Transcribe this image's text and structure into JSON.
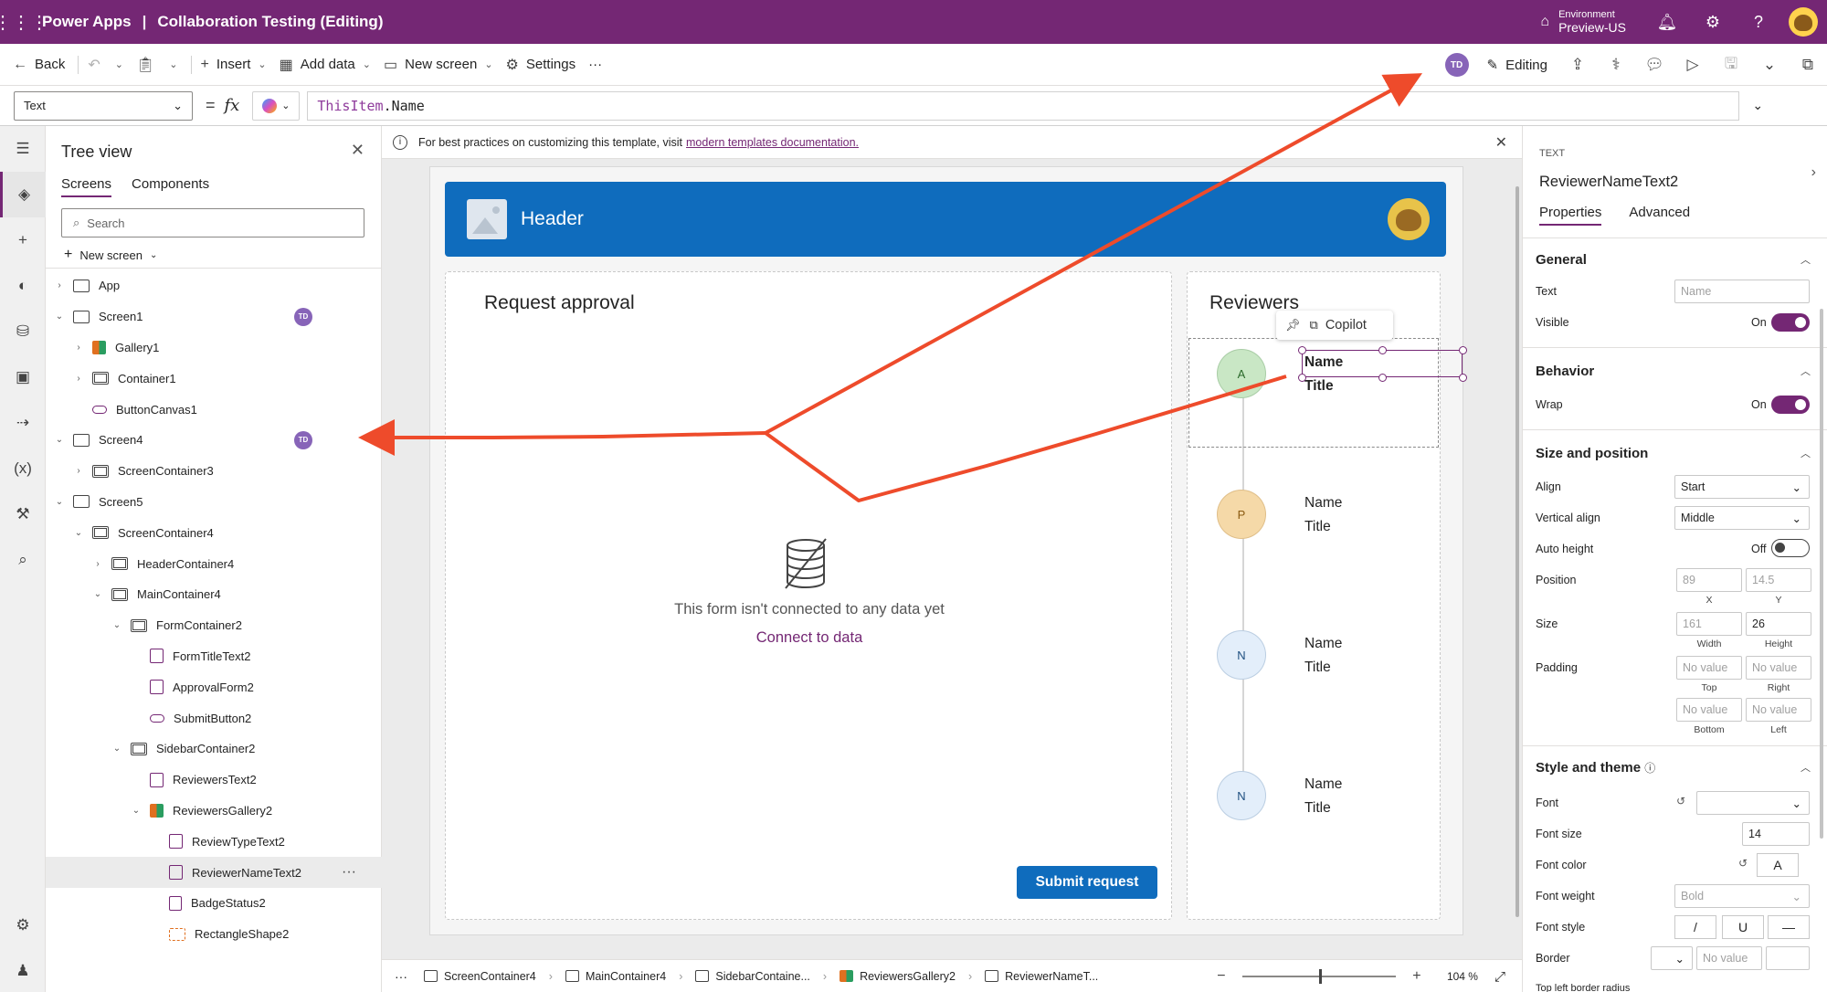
{
  "topbar": {
    "app_name": "Power Apps",
    "separator": "|",
    "doc_title": "Collaboration Testing (Editing)",
    "env_label": "Environment",
    "env_value": "Preview-US",
    "color": "#742774"
  },
  "cmdbar": {
    "back": "Back",
    "insert": "Insert",
    "add_data": "Add data",
    "new_screen": "New screen",
    "settings": "Settings",
    "more": "···",
    "user_initials": "TD",
    "editing": "Editing"
  },
  "formula": {
    "property": "Text",
    "eq": "=",
    "fx": "fx",
    "expr_this": "ThisItem",
    "expr_rest": ".Name"
  },
  "tree": {
    "title": "Tree view",
    "tabs": [
      "Screens",
      "Components"
    ],
    "search_placeholder": "Search",
    "new_screen": "New screen",
    "items": [
      {
        "label": "App",
        "depth": 0,
        "chev": ">",
        "icon": "app",
        "badge": ""
      },
      {
        "label": "Screen1",
        "depth": 0,
        "chev": "v",
        "icon": "screen",
        "badge": "TD"
      },
      {
        "label": "Gallery1",
        "depth": 1,
        "chev": ">",
        "icon": "gallery",
        "badge": ""
      },
      {
        "label": "Container1",
        "depth": 1,
        "chev": ">",
        "icon": "container",
        "badge": ""
      },
      {
        "label": "ButtonCanvas1",
        "depth": 1,
        "chev": "",
        "icon": "button",
        "badge": ""
      },
      {
        "label": "Screen4",
        "depth": 0,
        "chev": "v",
        "icon": "screen",
        "badge": "TD"
      },
      {
        "label": "ScreenContainer3",
        "depth": 1,
        "chev": ">",
        "icon": "container",
        "badge": ""
      },
      {
        "label": "Screen5",
        "depth": 0,
        "chev": "v",
        "icon": "screen",
        "badge": ""
      },
      {
        "label": "ScreenContainer4",
        "depth": 1,
        "chev": "v",
        "icon": "container",
        "badge": ""
      },
      {
        "label": "HeaderContainer4",
        "depth": 2,
        "chev": ">",
        "icon": "hcontainer",
        "badge": ""
      },
      {
        "label": "MainContainer4",
        "depth": 2,
        "chev": "v",
        "icon": "hcontainer",
        "badge": ""
      },
      {
        "label": "FormContainer2",
        "depth": 3,
        "chev": "v",
        "icon": "container",
        "badge": ""
      },
      {
        "label": "FormTitleText2",
        "depth": 4,
        "chev": "",
        "icon": "text",
        "badge": ""
      },
      {
        "label": "ApprovalForm2",
        "depth": 4,
        "chev": "",
        "icon": "text",
        "badge": ""
      },
      {
        "label": "SubmitButton2",
        "depth": 4,
        "chev": "",
        "icon": "button",
        "badge": ""
      },
      {
        "label": "SidebarContainer2",
        "depth": 3,
        "chev": "v",
        "icon": "container",
        "badge": ""
      },
      {
        "label": "ReviewersText2",
        "depth": 4,
        "chev": "",
        "icon": "text",
        "badge": ""
      },
      {
        "label": "ReviewersGallery2",
        "depth": 4,
        "chev": "v",
        "icon": "gallery",
        "badge": ""
      },
      {
        "label": "ReviewTypeText2",
        "depth": 5,
        "chev": "",
        "icon": "text",
        "badge": ""
      },
      {
        "label": "ReviewerNameText2",
        "depth": 5,
        "chev": "",
        "icon": "text",
        "badge": "",
        "selected": true,
        "more": "···"
      },
      {
        "label": "BadgeStatus2",
        "depth": 5,
        "chev": "",
        "icon": "badge",
        "badge": ""
      },
      {
        "label": "RectangleShape2",
        "depth": 5,
        "chev": "",
        "icon": "shape",
        "badge": ""
      }
    ]
  },
  "info": {
    "text": "For best practices on customizing this template, visit",
    "link": "modern templates documentation."
  },
  "app_canvas": {
    "header_title": "Header",
    "form_title": "Request approval",
    "no_data": "This form isn't connected to any data yet",
    "connect": "Connect to data",
    "submit": "Submit request",
    "reviewers_title": "Reviewers",
    "copilot": "Copilot",
    "reviewers": [
      {
        "initial": "A",
        "name": "Name",
        "title": "Title",
        "bg": "#c9e7c5",
        "fg": "#2b6a2b"
      },
      {
        "initial": "P",
        "name": "Name",
        "title": "Title",
        "bg": "#f5d9a8",
        "fg": "#8a5a10"
      },
      {
        "initial": "N",
        "name": "Name",
        "title": "Title",
        "bg": "#e3eefa",
        "fg": "#1f4f80"
      },
      {
        "initial": "N",
        "name": "Name",
        "title": "Title",
        "bg": "#e3eefa",
        "fg": "#1f4f80"
      }
    ]
  },
  "breadcrumb": {
    "more": "···",
    "items": [
      "ScreenContainer4",
      "MainContainer4",
      "SidebarContaine...",
      "ReviewersGallery2",
      "ReviewerNameT..."
    ],
    "zoom": "104 %"
  },
  "props": {
    "kind": "TEXT",
    "name": "ReviewerNameText2",
    "tabs": [
      "Properties",
      "Advanced"
    ],
    "general": "General",
    "text_label": "Text",
    "text_value": "Name",
    "visible_label": "Visible",
    "visible_state": "On",
    "behavior": "Behavior",
    "wrap_label": "Wrap",
    "wrap_state": "On",
    "size_pos": "Size and position",
    "align_label": "Align",
    "align_value": "Start",
    "valign_label": "Vertical align",
    "valign_value": "Middle",
    "autoh_label": "Auto height",
    "autoh_state": "Off",
    "position_label": "Position",
    "pos_x": "89",
    "pos_y": "14.5",
    "x_caption": "X",
    "y_caption": "Y",
    "size_label": "Size",
    "width": "161",
    "height": "26",
    "width_caption": "Width",
    "height_caption": "Height",
    "padding_label": "Padding",
    "no_value": "No value",
    "top_caption": "Top",
    "right_caption": "Right",
    "bottom_caption": "Bottom",
    "left_caption": "Left",
    "style": "Style and theme",
    "font_label": "Font",
    "font_size_label": "Font size",
    "font_size": "14",
    "font_color_label": "Font color",
    "font_color_glyph": "A",
    "font_weight_label": "Font weight",
    "font_weight": "Bold",
    "font_style_label": "Font style",
    "italic": "/",
    "underline": "U",
    "strike": "—",
    "border_label": "Border",
    "tl_radius_label": "Top left border radius"
  }
}
